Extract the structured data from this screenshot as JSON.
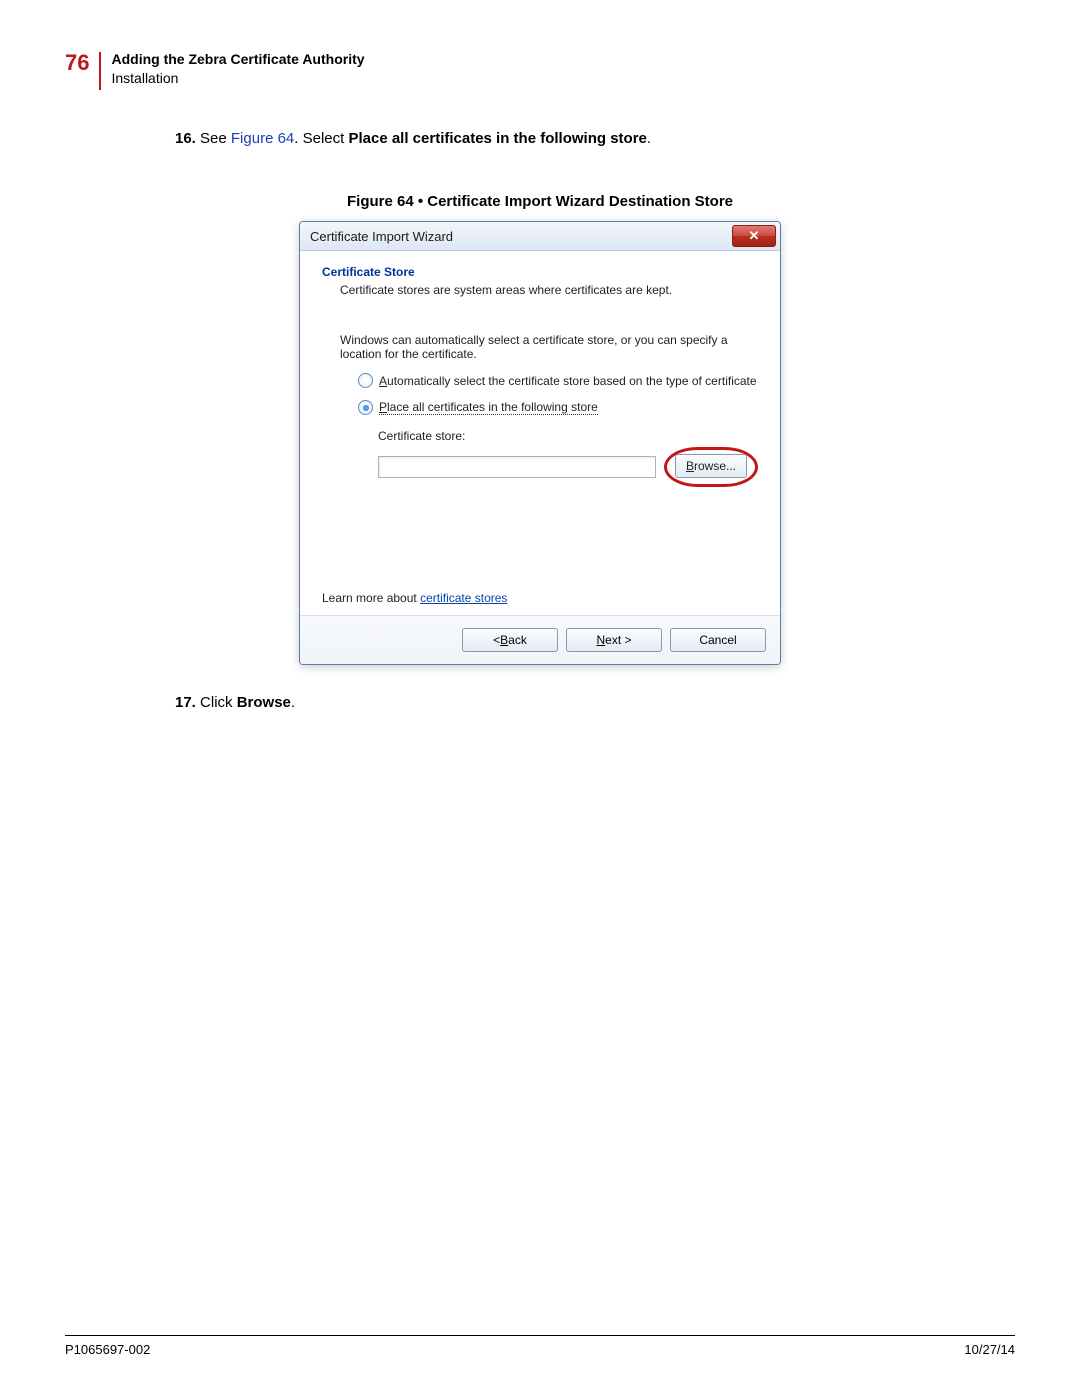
{
  "header": {
    "page_number": "76",
    "title": "Adding the Zebra Certificate Authority",
    "subtitle": "Installation"
  },
  "step16": {
    "num": "16.",
    "pre": "See ",
    "figref": "Figure 64",
    "mid": ". Select ",
    "bold": "Place all certificates in the following store",
    "end": "."
  },
  "figure_caption": "Figure 64 • Certificate Import Wizard Destination Store",
  "dialog": {
    "title": "Certificate Import Wizard",
    "close_glyph": "✕",
    "section_title": "Certificate Store",
    "section_sub": "Certificate stores are system areas where certificates are kept.",
    "para": "Windows can automatically select a certificate store, or you can specify a location for the certificate.",
    "radio_auto_pre": "A",
    "radio_auto_rest": "utomatically select the certificate store based on the type of certificate",
    "radio_place_pre": "P",
    "radio_place_rest": "lace all certificates in the following store",
    "cert_store_label": "Certificate store:",
    "browse_pre": "B",
    "browse_rest": "rowse...",
    "learn_pre": "Learn more about ",
    "learn_link": "certificate stores",
    "back_pre": "< ",
    "back_u": "B",
    "back_rest": "ack",
    "next_u": "N",
    "next_rest": "ext >",
    "cancel": "Cancel"
  },
  "step17": {
    "num": "17.",
    "pre": "Click ",
    "bold": "Browse",
    "end": "."
  },
  "footer": {
    "doc_id": "P1065697-002",
    "date": "10/27/14"
  }
}
